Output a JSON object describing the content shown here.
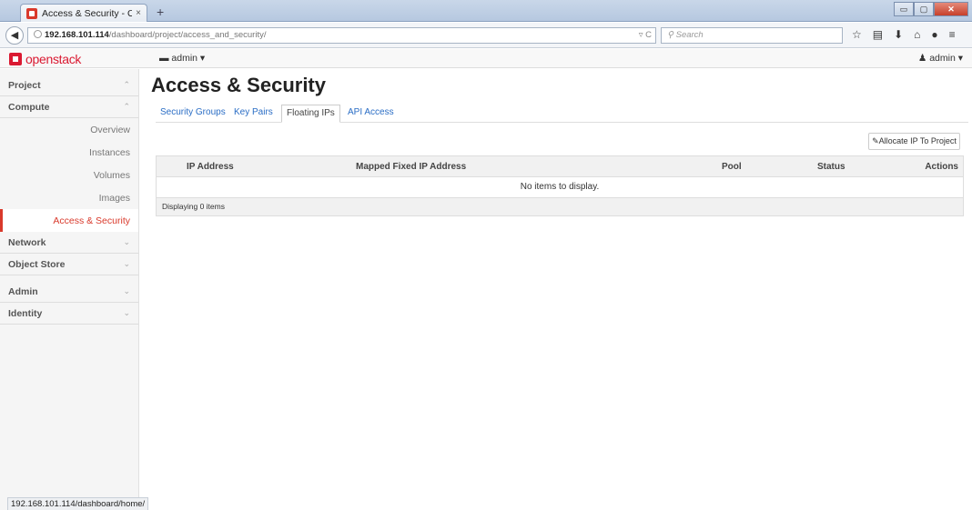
{
  "browser": {
    "tab_title": "Access & Security - OpenS...",
    "tab_close": "×",
    "new_tab": "+",
    "url_host": "192.168.101.114",
    "url_path": "/dashboard/project/access_and_security/",
    "url_tools": "▿ C",
    "search_placeholder": "Search",
    "status_url": "192.168.101.114/dashboard/home/",
    "window_buttons": [
      "▭",
      "▢",
      "✕"
    ],
    "toolbar_icons": [
      "star-icon",
      "bookmarks-icon",
      "download-icon",
      "home-icon",
      "chat-icon",
      "menu-icon"
    ]
  },
  "header": {
    "logo_text": "openstack",
    "project_dropdown": "admin ▾",
    "user_dropdown": "admin ▾",
    "brand_color": "#da1a32"
  },
  "sidebar": {
    "project": "Project",
    "compute": "Compute",
    "items": [
      "Overview",
      "Instances",
      "Volumes",
      "Images",
      "Access & Security"
    ],
    "active_item": "Access & Security",
    "network": "Network",
    "object_store": "Object Store",
    "admin": "Admin",
    "identity": "Identity"
  },
  "main": {
    "title": "Access & Security",
    "tabs": [
      "Security Groups",
      "Key Pairs",
      "Floating IPs",
      "API Access"
    ],
    "active_tab": "Floating IPs",
    "allocate_button": "Allocate IP To Project",
    "table": {
      "columns": [
        "IP Address",
        "Mapped Fixed IP Address",
        "Pool",
        "Status",
        "Actions"
      ],
      "empty_message": "No items to display.",
      "footer": "Displaying 0 items"
    }
  }
}
